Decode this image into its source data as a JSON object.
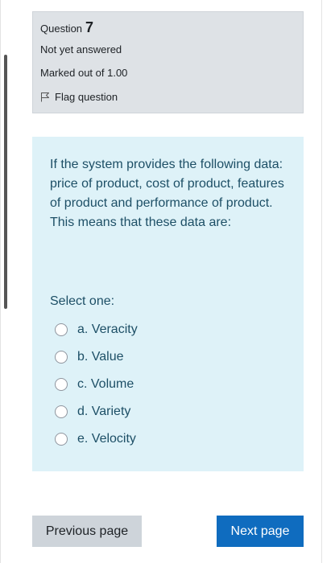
{
  "info": {
    "question_label": "Question",
    "question_number": "7",
    "state": "Not yet answered",
    "grade": "Marked out of 1.00",
    "flag_label": "Flag question"
  },
  "question": {
    "text": "If the system provides the following data: price of product, cost of product, features of product and performance of product. This means that these data are:",
    "prompt": "Select one:",
    "answers": [
      "a. Veracity",
      "b. Value",
      "c. Volume",
      "d. Variety",
      "e. Velocity"
    ]
  },
  "navigation": {
    "previous_label": "Previous page",
    "next_label": "Next page"
  },
  "colors": {
    "info_bg": "#dee2e6",
    "content_bg": "#def2f8",
    "primary": "#0f6cbf",
    "secondary": "#ced4da"
  }
}
